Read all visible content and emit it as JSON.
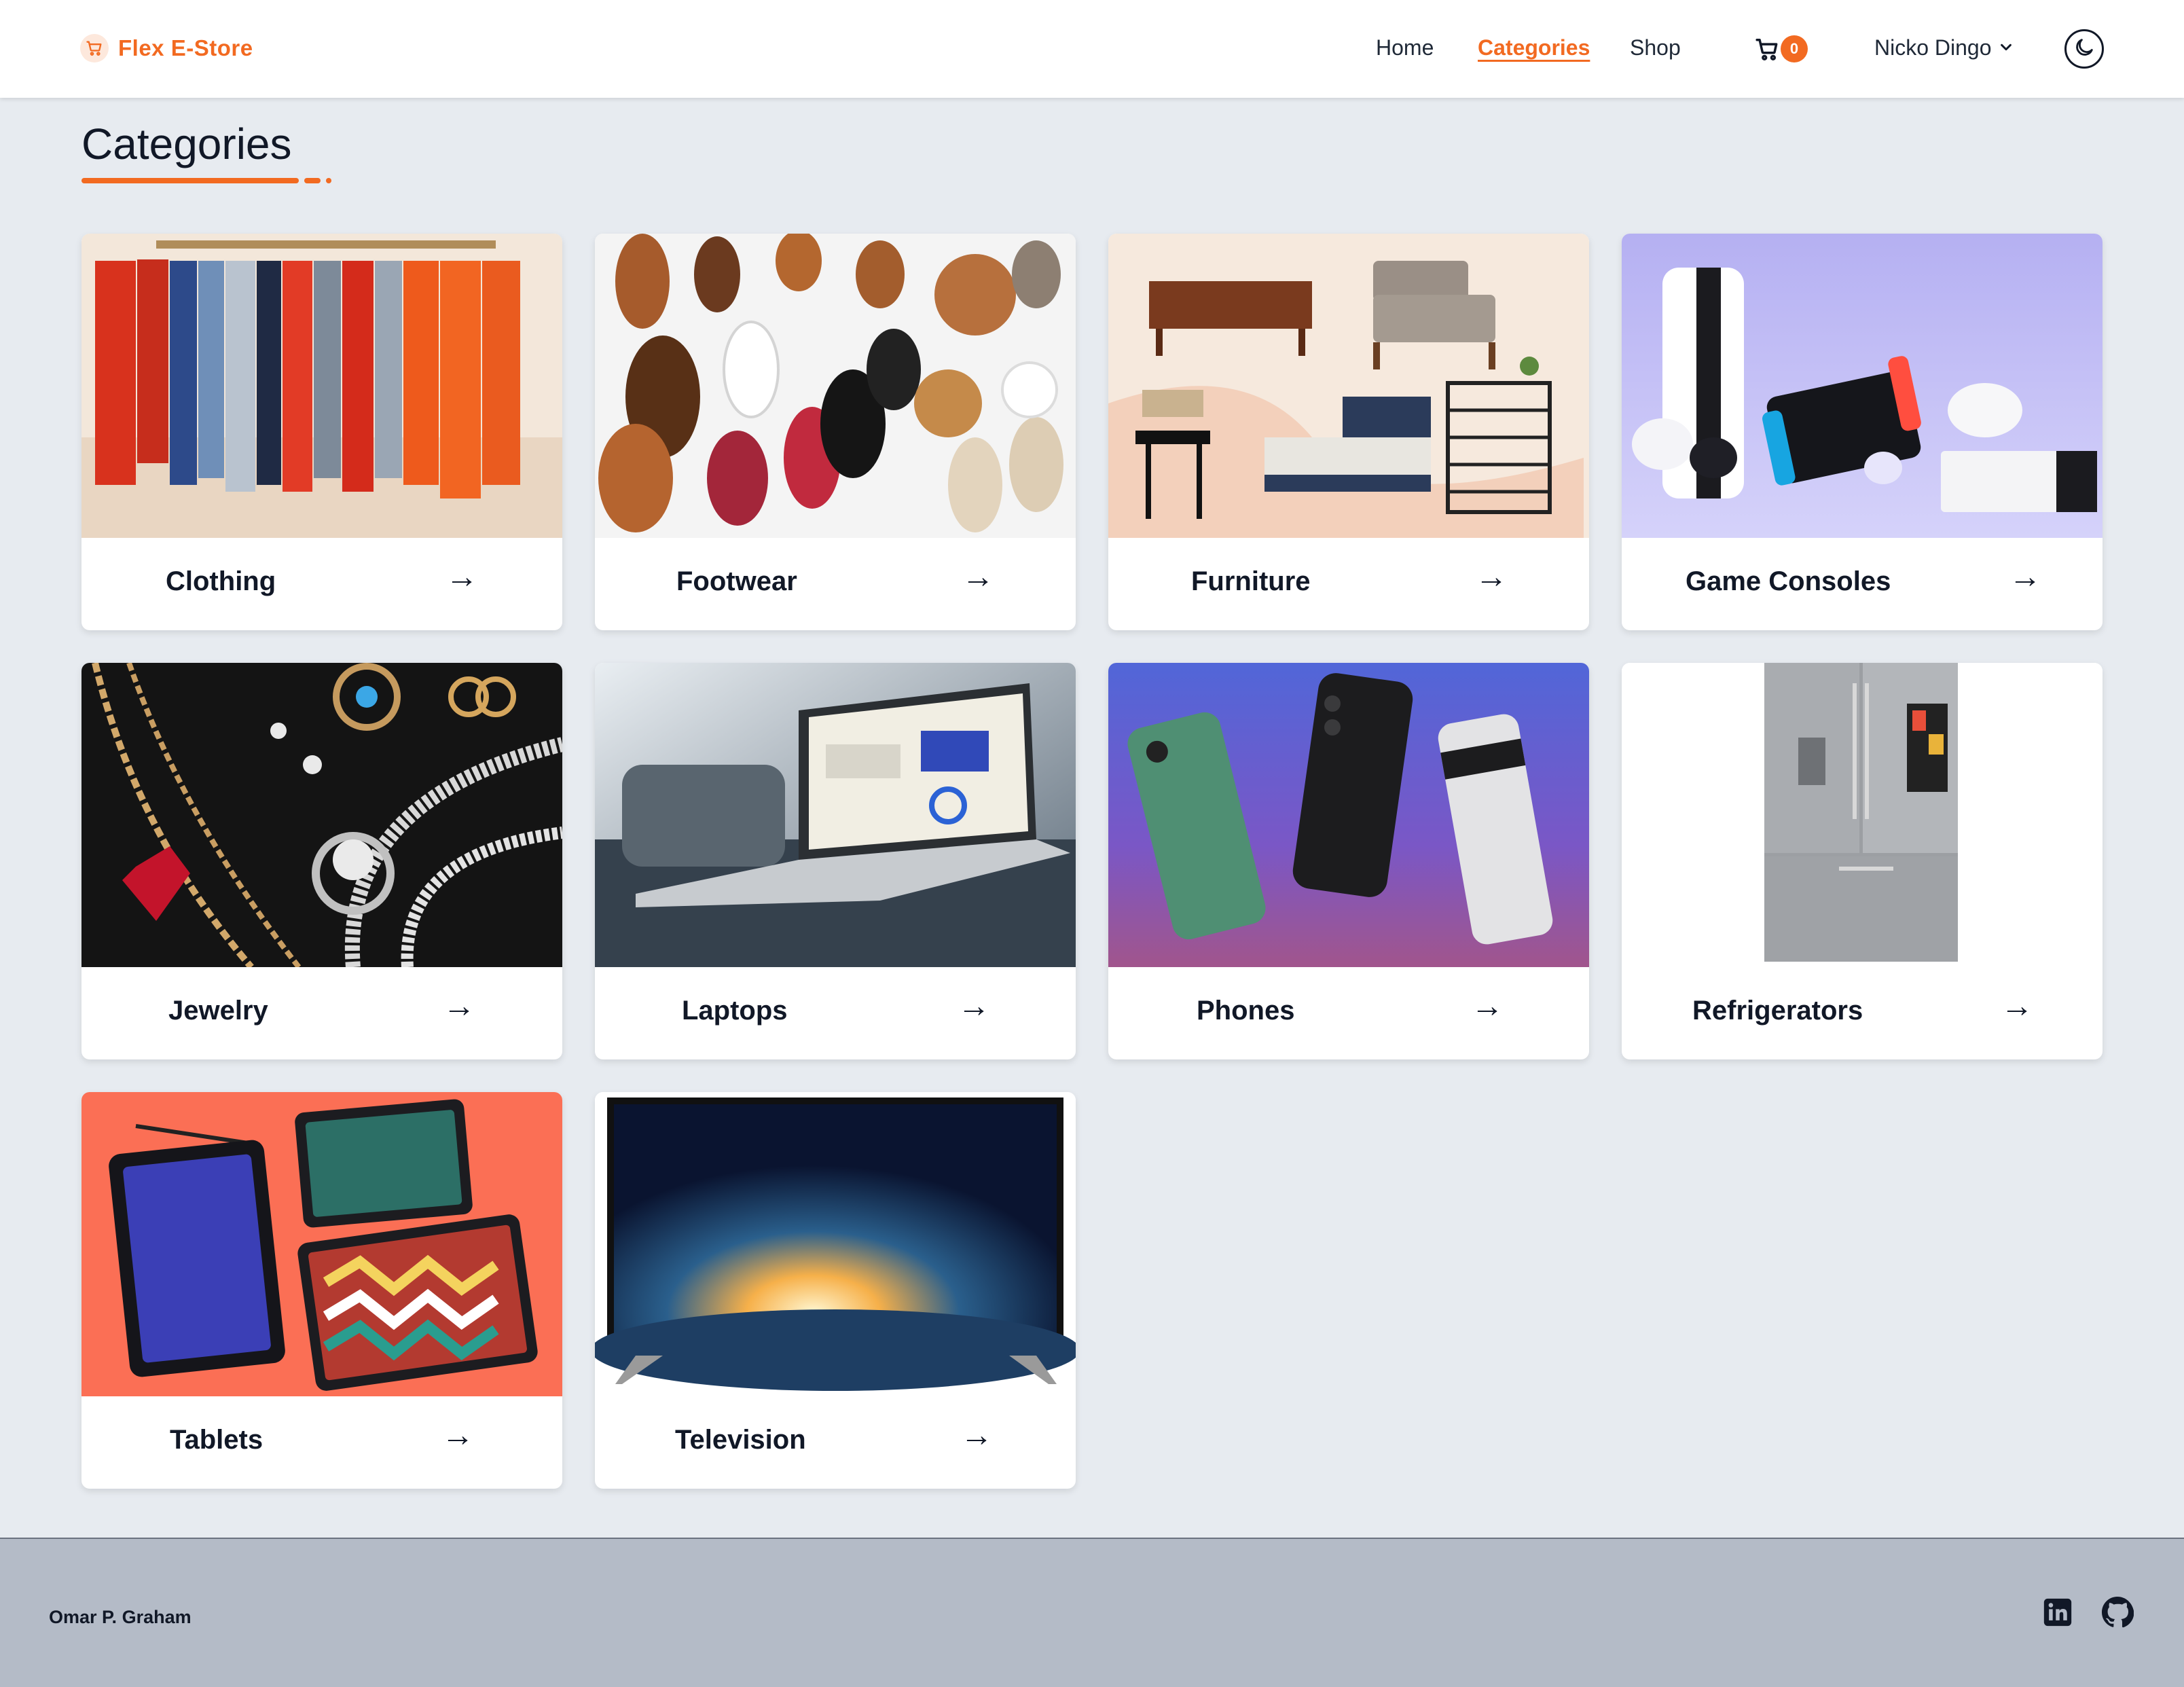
{
  "header": {
    "brand": "Flex E-Store",
    "nav": [
      {
        "label": "Home",
        "active": false
      },
      {
        "label": "Categories",
        "active": true
      },
      {
        "label": "Shop",
        "active": false
      }
    ],
    "cart_count": "0",
    "user_name": "Nicko Dingo",
    "icons": {
      "brand": "shopping-cart-icon",
      "cart": "shopping-cart-icon",
      "user_menu": "chevron-down-icon",
      "theme": "moon-icon"
    }
  },
  "page": {
    "title": "Categories"
  },
  "categories": [
    {
      "label": "Clothing",
      "image": "clothing rack image"
    },
    {
      "label": "Footwear",
      "image": "shoes flat-lay image"
    },
    {
      "label": "Furniture",
      "image": "furniture collage image"
    },
    {
      "label": "Game Consoles",
      "image": "game consoles image"
    },
    {
      "label": "Jewelry",
      "image": "jewelry image"
    },
    {
      "label": "Laptops",
      "image": "laptop image"
    },
    {
      "label": "Phones",
      "image": "phones image"
    },
    {
      "label": "Refrigerators",
      "image": "refrigerator image"
    },
    {
      "label": "Tablets",
      "image": "tablets image"
    },
    {
      "label": "Television",
      "image": "television image"
    }
  ],
  "card_arrow": "→",
  "footer": {
    "name": "Omar P. Graham",
    "icons": [
      "linkedin-icon",
      "github-icon"
    ]
  },
  "colors": {
    "accent": "#f26a21",
    "page_bg": "#e7ebf0",
    "footer_bg": "#b4bbc7"
  }
}
